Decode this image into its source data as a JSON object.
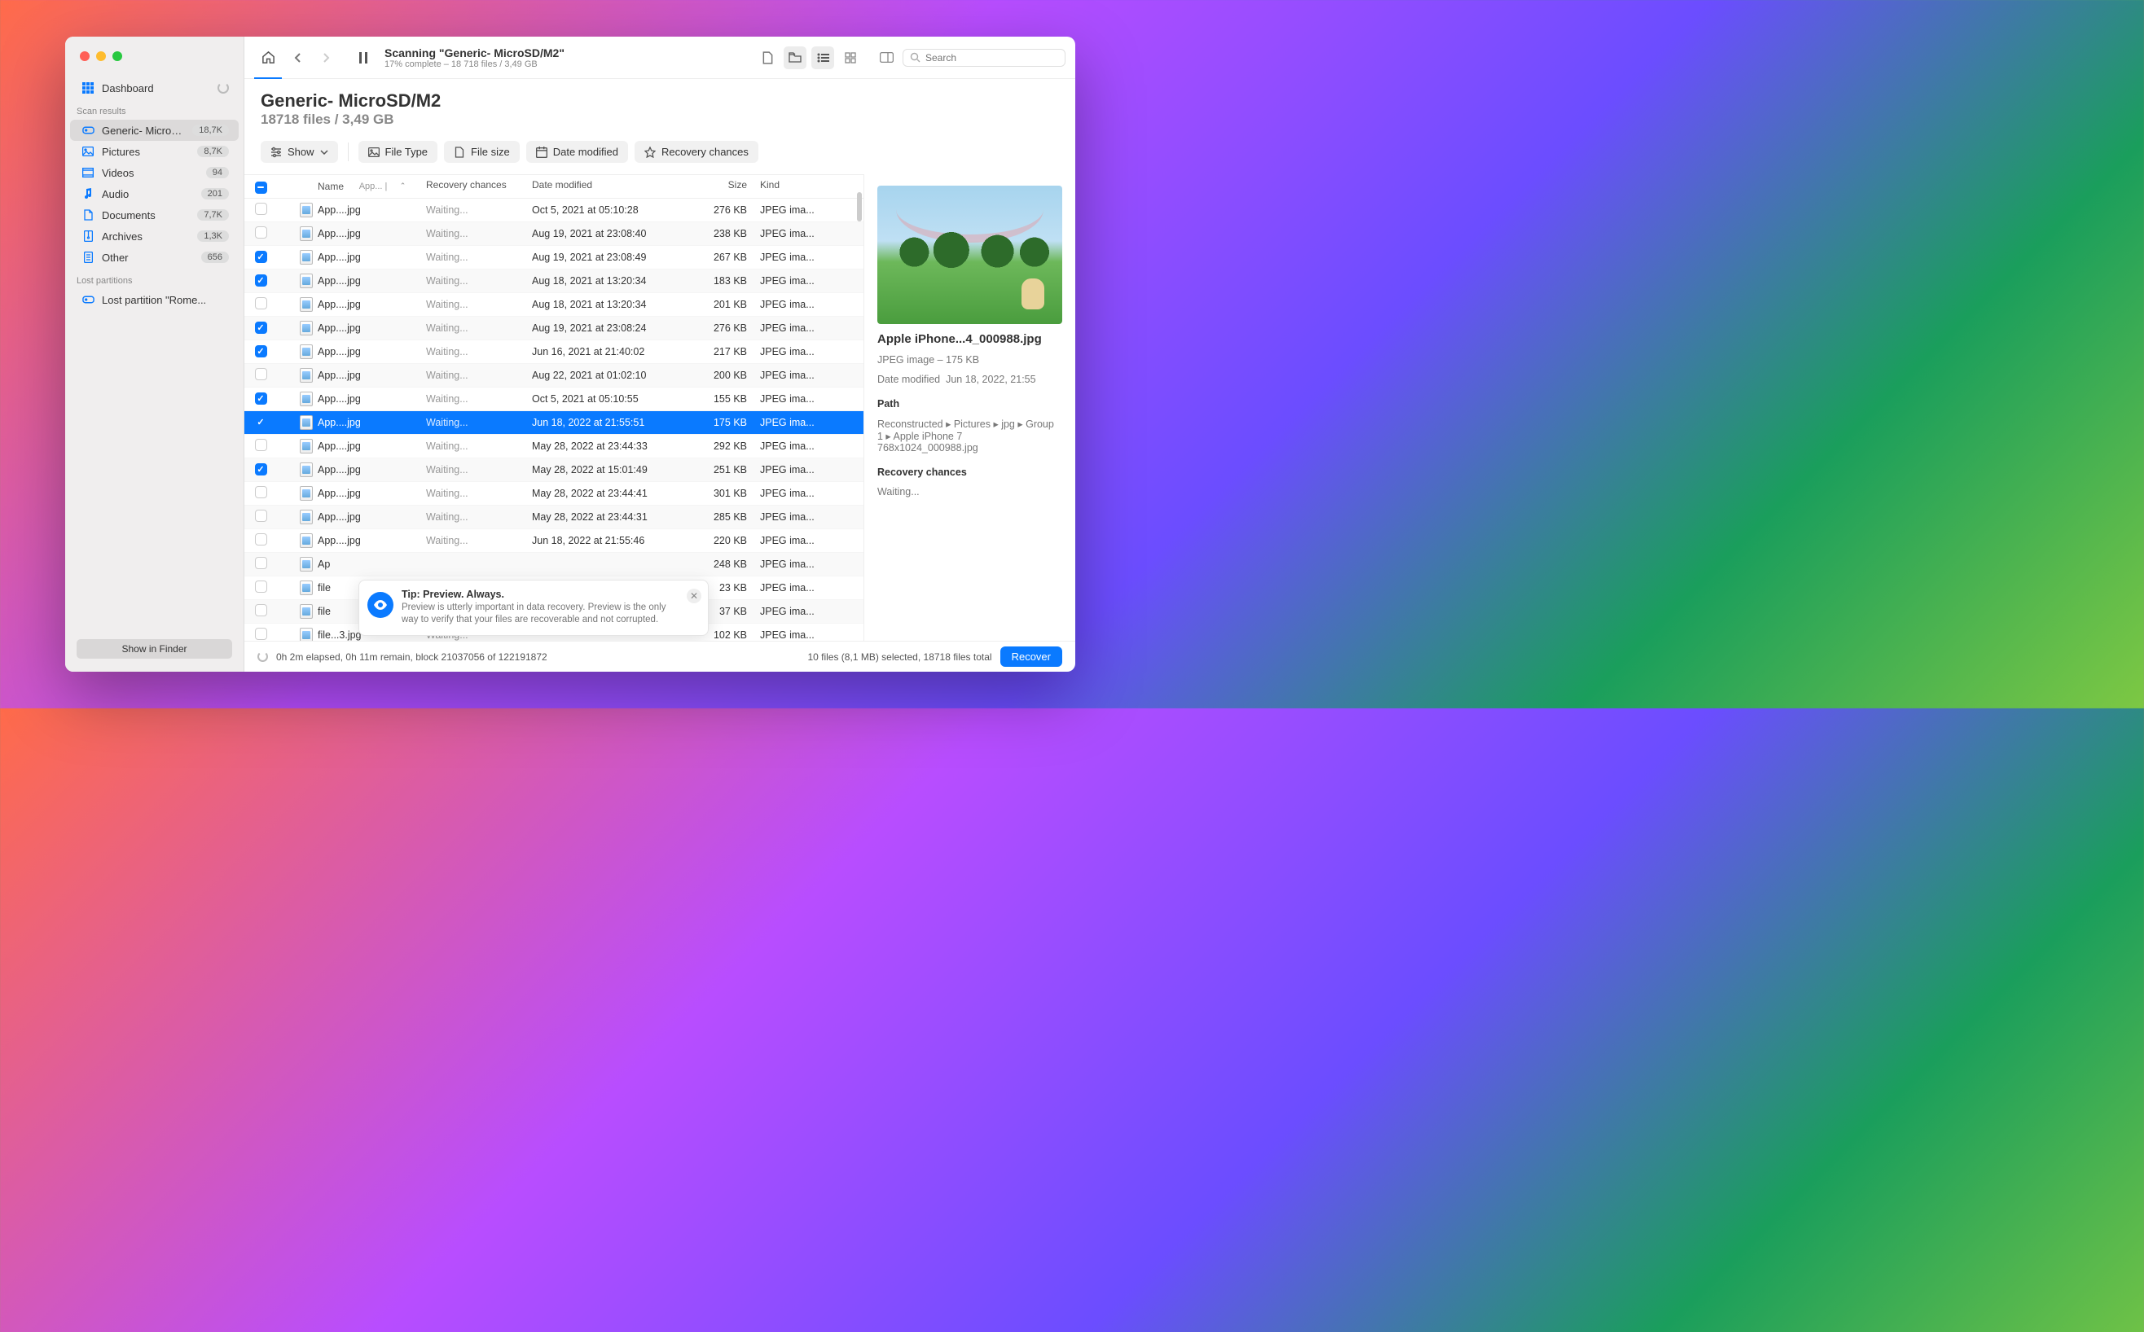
{
  "sidebar": {
    "dashboard": "Dashboard",
    "scan_results_header": "Scan results",
    "lost_partitions_header": "Lost partitions",
    "items": [
      {
        "label": "Generic- MicroS...",
        "badge": "18,7K",
        "icon": "disk"
      },
      {
        "label": "Pictures",
        "badge": "8,7K",
        "icon": "picture"
      },
      {
        "label": "Videos",
        "badge": "94",
        "icon": "video"
      },
      {
        "label": "Audio",
        "badge": "201",
        "icon": "audio"
      },
      {
        "label": "Documents",
        "badge": "7,7K",
        "icon": "document"
      },
      {
        "label": "Archives",
        "badge": "1,3K",
        "icon": "archive"
      },
      {
        "label": "Other",
        "badge": "656",
        "icon": "other"
      }
    ],
    "lost": [
      {
        "label": "Lost partition \"Rome..."
      }
    ],
    "finder_btn": "Show in Finder"
  },
  "toolbar": {
    "title": "Scanning \"Generic- MicroSD/M2\"",
    "subtitle": "17% complete – 18 718 files / 3,49 GB",
    "search_placeholder": "Search"
  },
  "header": {
    "title": "Generic- MicroSD/M2",
    "subtitle": "18718 files / 3,49 GB"
  },
  "filters": {
    "show": "Show",
    "filetype": "File Type",
    "filesize": "File size",
    "date": "Date modified",
    "recovery": "Recovery chances"
  },
  "columns": {
    "name": "Name",
    "name_hint": "App... |",
    "recovery": "Recovery chances",
    "date": "Date modified",
    "size": "Size",
    "kind": "Kind"
  },
  "rows": [
    {
      "chk": false,
      "name": "App....jpg",
      "rec": "Waiting...",
      "date": "Oct 5, 2021 at 05:10:28",
      "size": "276 KB",
      "kind": "JPEG ima..."
    },
    {
      "chk": false,
      "name": "App....jpg",
      "rec": "Waiting...",
      "date": "Aug 19, 2021 at 23:08:40",
      "size": "238 KB",
      "kind": "JPEG ima..."
    },
    {
      "chk": true,
      "name": "App....jpg",
      "rec": "Waiting...",
      "date": "Aug 19, 2021 at 23:08:49",
      "size": "267 KB",
      "kind": "JPEG ima..."
    },
    {
      "chk": true,
      "name": "App....jpg",
      "rec": "Waiting...",
      "date": "Aug 18, 2021 at 13:20:34",
      "size": "183 KB",
      "kind": "JPEG ima..."
    },
    {
      "chk": false,
      "name": "App....jpg",
      "rec": "Waiting...",
      "date": "Aug 18, 2021 at 13:20:34",
      "size": "201 KB",
      "kind": "JPEG ima..."
    },
    {
      "chk": true,
      "name": "App....jpg",
      "rec": "Waiting...",
      "date": "Aug 19, 2021 at 23:08:24",
      "size": "276 KB",
      "kind": "JPEG ima..."
    },
    {
      "chk": true,
      "name": "App....jpg",
      "rec": "Waiting...",
      "date": "Jun 16, 2021 at 21:40:02",
      "size": "217 KB",
      "kind": "JPEG ima..."
    },
    {
      "chk": false,
      "name": "App....jpg",
      "rec": "Waiting...",
      "date": "Aug 22, 2021 at 01:02:10",
      "size": "200 KB",
      "kind": "JPEG ima..."
    },
    {
      "chk": true,
      "name": "App....jpg",
      "rec": "Waiting...",
      "date": "Oct 5, 2021 at 05:10:55",
      "size": "155 KB",
      "kind": "JPEG ima..."
    },
    {
      "chk": true,
      "name": "App....jpg",
      "rec": "Waiting...",
      "date": "Jun 18, 2022 at 21:55:51",
      "size": "175 KB",
      "kind": "JPEG ima...",
      "selected": true
    },
    {
      "chk": false,
      "name": "App....jpg",
      "rec": "Waiting...",
      "date": "May 28, 2022 at 23:44:33",
      "size": "292 KB",
      "kind": "JPEG ima..."
    },
    {
      "chk": true,
      "name": "App....jpg",
      "rec": "Waiting...",
      "date": "May 28, 2022 at 15:01:49",
      "size": "251 KB",
      "kind": "JPEG ima..."
    },
    {
      "chk": false,
      "name": "App....jpg",
      "rec": "Waiting...",
      "date": "May 28, 2022 at 23:44:41",
      "size": "301 KB",
      "kind": "JPEG ima..."
    },
    {
      "chk": false,
      "name": "App....jpg",
      "rec": "Waiting...",
      "date": "May 28, 2022 at 23:44:31",
      "size": "285 KB",
      "kind": "JPEG ima..."
    },
    {
      "chk": false,
      "name": "App....jpg",
      "rec": "Waiting...",
      "date": "Jun 18, 2022 at 21:55:46",
      "size": "220 KB",
      "kind": "JPEG ima..."
    },
    {
      "chk": false,
      "name": "Ap",
      "rec": "",
      "date": "",
      "size": "248 KB",
      "kind": "JPEG ima..."
    },
    {
      "chk": false,
      "name": "file",
      "rec": "",
      "date": "",
      "size": "23 KB",
      "kind": "JPEG ima..."
    },
    {
      "chk": false,
      "name": "file",
      "rec": "",
      "date": "",
      "size": "37 KB",
      "kind": "JPEG ima..."
    },
    {
      "chk": false,
      "name": "file...3.jpg",
      "rec": "Waiting...",
      "date": "—",
      "size": "102 KB",
      "kind": "JPEG ima..."
    }
  ],
  "preview": {
    "name": "Apple iPhone...4_000988.jpg",
    "meta": "JPEG image – 175 KB",
    "date_label": "Date modified",
    "date_val": "Jun 18, 2022, 21:55",
    "path_label": "Path",
    "path_val": "Reconstructed ▸ Pictures ▸ jpg ▸ Group 1 ▸ Apple iPhone 7 768x1024_000988.jpg",
    "rec_label": "Recovery chances",
    "rec_val": "Waiting..."
  },
  "footer": {
    "status": "0h 2m elapsed, 0h 11m remain, block 21037056 of 122191872",
    "selection": "10 files (8,1 MB) selected, 18718 files total",
    "recover": "Recover"
  },
  "tip": {
    "title": "Tip: Preview. Always.",
    "body": "Preview is utterly important in data recovery. Preview is the only way to verify that your files are recoverable and not corrupted."
  }
}
